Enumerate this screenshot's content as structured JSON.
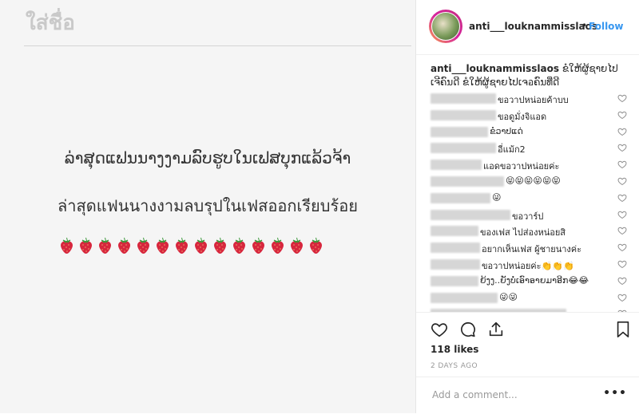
{
  "post": {
    "image_title": "ใส่ชื่อ",
    "line1": "ລ່າສຸດແຟນນາງງາມລົບຮູບໃນເຟສບຸກແລ້ວຈ້າ",
    "line2": "ล่าสุดแฟนนางงามลบรุปในเฟสออกเรียบร้อย",
    "emoji": "strawberry",
    "emoji_count": 14
  },
  "header": {
    "username": "anti___louknammisslaos",
    "dot": "•",
    "follow_label": "Follow",
    "avatar_icon": "avatar"
  },
  "caption": {
    "username": "anti___louknammisslaos",
    "text": "ຂໍໃຫ້ຜູ້ຊາຍໄປເຈີຄົນດີ ຂໍໃຫ້ຜູ້ຊາຍໄປເຈอຄົນທີ່ດີ"
  },
  "comments": [
    {
      "text": "ขอวาปหน่อยค้าบบ",
      "blur_width": 82
    },
    {
      "text": "ขอดูมั่งจิแอด",
      "blur_width": 82
    },
    {
      "text": "ຂໍວາປແດ່",
      "blur_width": 72
    },
    {
      "text": "อี่แม้ก2",
      "blur_width": 82
    },
    {
      "text": "แอดขอวาปหน่อยค่ะ",
      "blur_width": 64
    },
    {
      "text": "😝😝😝😝😝😝",
      "blur_width": 92
    },
    {
      "text": "😜",
      "blur_width": 75
    },
    {
      "text": "ขอวาร์ป",
      "blur_width": 100
    },
    {
      "text": "ของเฟส ไปส่องหน่อยสิ",
      "blur_width": 60
    },
    {
      "text": "อยากเห็นเฟส ผู้ชายนางค่ะ",
      "blur_width": 62
    },
    {
      "text": "ขอวาปหน่อยค่ะ👏👏👏",
      "blur_width": 62
    },
    {
      "text": "ຍ້ງງ..ຍັງບໍ່ເອົາອາຍມາອີກ😂😂",
      "blur_width": 60
    },
    {
      "text": "😜😜",
      "blur_width": 84
    },
    {
      "text": "",
      "blur_width": 170
    }
  ],
  "likes": "118 likes",
  "date": "2 DAYS AGO",
  "comment_placeholder": "Add a comment...",
  "more_label": "•••",
  "colors": {
    "accent": "#3897f0",
    "text": "#262626",
    "muted": "#999999",
    "strawberry": "#d7263d"
  }
}
